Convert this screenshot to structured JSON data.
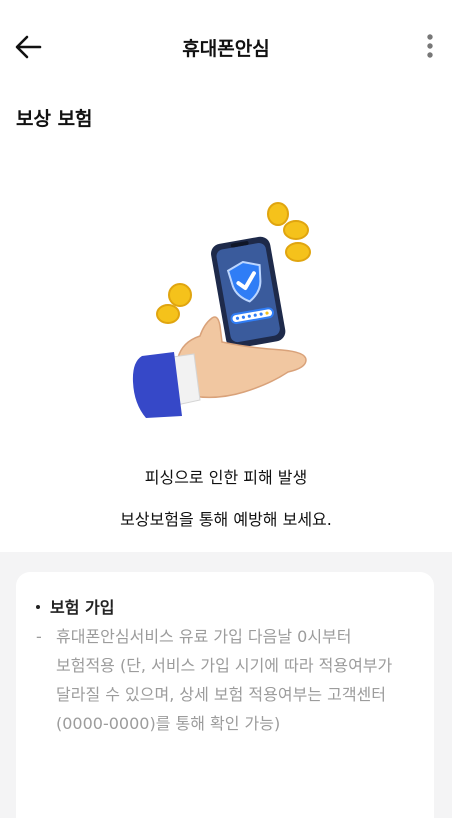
{
  "header": {
    "title": "휴대폰안심"
  },
  "section": {
    "title": "보상 보험"
  },
  "description": {
    "line1": "피싱으로 인한 피해 발생",
    "line2": "보상보험을 통해 예방해 보세요."
  },
  "card": {
    "heading": "보험 가입",
    "dash": "-",
    "body": "휴대폰안심서비스 유료 가입 다음날 0시부터 보험적용 (단, 서비스 가입 시기에 따라 적용여부가 달라질 수 있으며, 상세 보험 적용여부는 고객센터(0000-0000)를 통해 확인 가능)"
  },
  "colors": {
    "text": "#111111",
    "muted": "#9c9c9c",
    "background_gray": "#f4f4f5",
    "phone": "#1e2a4a",
    "shield": "#2f7df6",
    "coin": "#f5c21b",
    "sleeve": "#3648c8"
  },
  "icons": {
    "back": "arrow-left-icon",
    "more": "more-vertical-icon"
  }
}
